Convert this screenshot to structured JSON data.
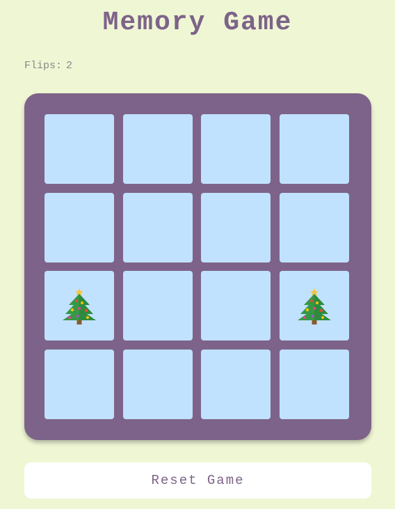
{
  "app": {
    "title": "Memory Game"
  },
  "stats": {
    "flips_label": "Flips:",
    "flips_value": "2"
  },
  "board": {
    "rows": 4,
    "cols": 4,
    "cards": [
      {
        "face": "hidden",
        "icon": null
      },
      {
        "face": "hidden",
        "icon": null
      },
      {
        "face": "hidden",
        "icon": null
      },
      {
        "face": "hidden",
        "icon": null
      },
      {
        "face": "hidden",
        "icon": null
      },
      {
        "face": "hidden",
        "icon": null
      },
      {
        "face": "hidden",
        "icon": null
      },
      {
        "face": "hidden",
        "icon": null
      },
      {
        "face": "up",
        "icon": "christmas-tree-icon"
      },
      {
        "face": "hidden",
        "icon": null
      },
      {
        "face": "hidden",
        "icon": null
      },
      {
        "face": "up",
        "icon": "christmas-tree-icon"
      },
      {
        "face": "hidden",
        "icon": null
      },
      {
        "face": "hidden",
        "icon": null
      },
      {
        "face": "hidden",
        "icon": null
      },
      {
        "face": "hidden",
        "icon": null
      }
    ]
  },
  "controls": {
    "reset_label": "Reset Game"
  },
  "colors": {
    "background": "#eff6d4",
    "board": "#7d6389",
    "card_back": "#c1e2fe",
    "accent": "#7d6389"
  }
}
